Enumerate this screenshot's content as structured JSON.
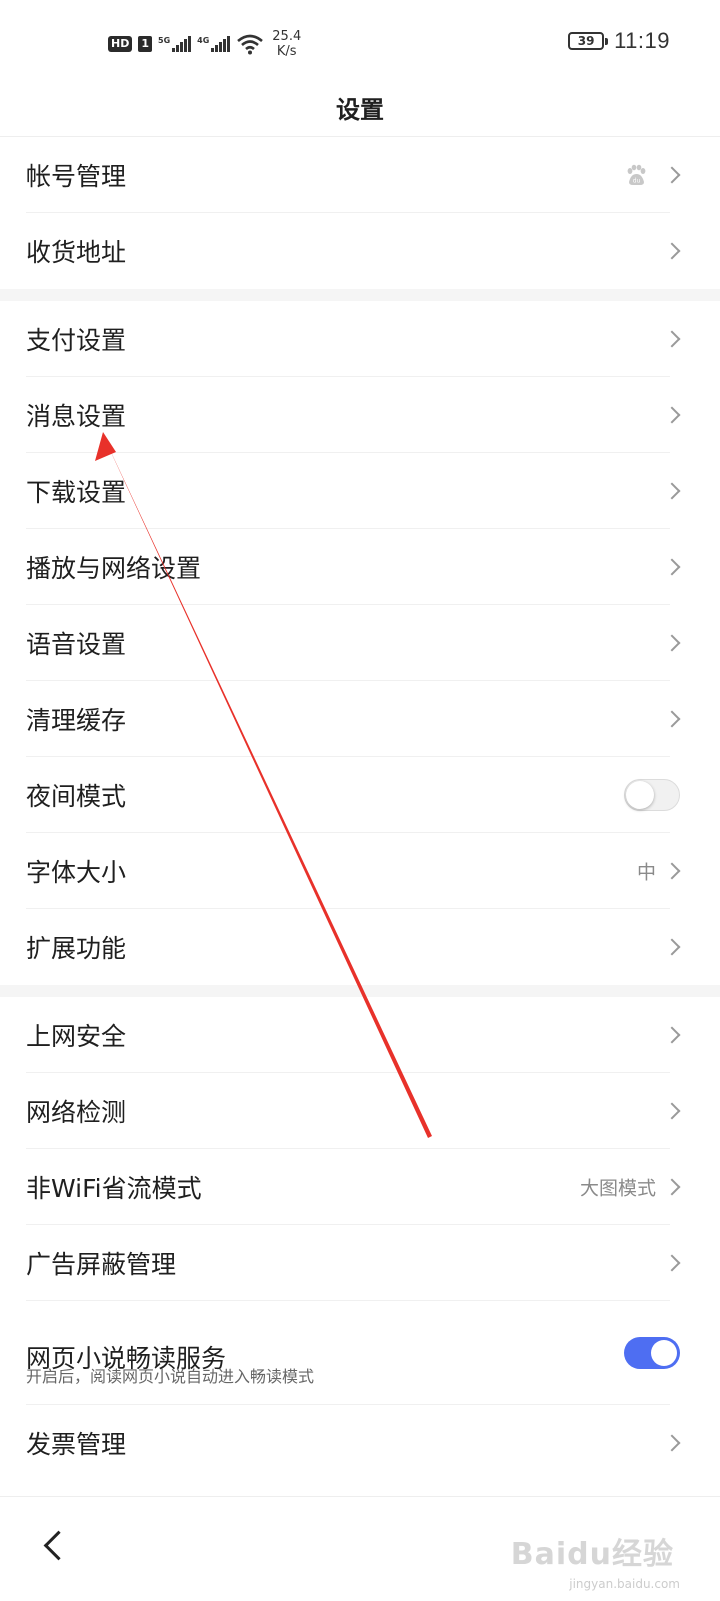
{
  "status_bar": {
    "hd": "HD",
    "sim": "1",
    "net1": "5G",
    "net2": "4G",
    "speed_value": "25.4",
    "speed_unit": "K/s",
    "battery": "39",
    "time": "11:19"
  },
  "header": {
    "title": "设置"
  },
  "sections": [
    {
      "items": [
        {
          "label": "帐号管理",
          "type": "link",
          "icon": "baidu-paw-icon"
        },
        {
          "label": "收货地址",
          "type": "link"
        }
      ]
    },
    {
      "items": [
        {
          "label": "支付设置",
          "type": "link"
        },
        {
          "label": "消息设置",
          "type": "link"
        },
        {
          "label": "下载设置",
          "type": "link"
        },
        {
          "label": "播放与网络设置",
          "type": "link"
        },
        {
          "label": "语音设置",
          "type": "link"
        },
        {
          "label": "清理缓存",
          "type": "link"
        },
        {
          "label": "夜间模式",
          "type": "toggle",
          "on": false
        },
        {
          "label": "字体大小",
          "type": "link",
          "value": "中"
        },
        {
          "label": "扩展功能",
          "type": "link"
        }
      ]
    },
    {
      "items": [
        {
          "label": "上网安全",
          "type": "link"
        },
        {
          "label": "网络检测",
          "type": "link"
        },
        {
          "label": "非WiFi省流模式",
          "type": "link",
          "value": "大图模式"
        },
        {
          "label": "广告屏蔽管理",
          "type": "link"
        },
        {
          "label": "网页小说畅读服务",
          "type": "toggle",
          "on": true,
          "sub": "开启后，阅读网页小说自动进入畅读模式"
        },
        {
          "label": "发票管理",
          "type": "link"
        }
      ]
    }
  ],
  "bottom_bar": {
    "back_icon": "chevron-left-icon",
    "watermark": "Baidu经验",
    "watermark_sub": "jingyan.baidu.com"
  },
  "colors": {
    "accent": "#4e6ef2",
    "annotation_arrow": "#e8312a"
  }
}
